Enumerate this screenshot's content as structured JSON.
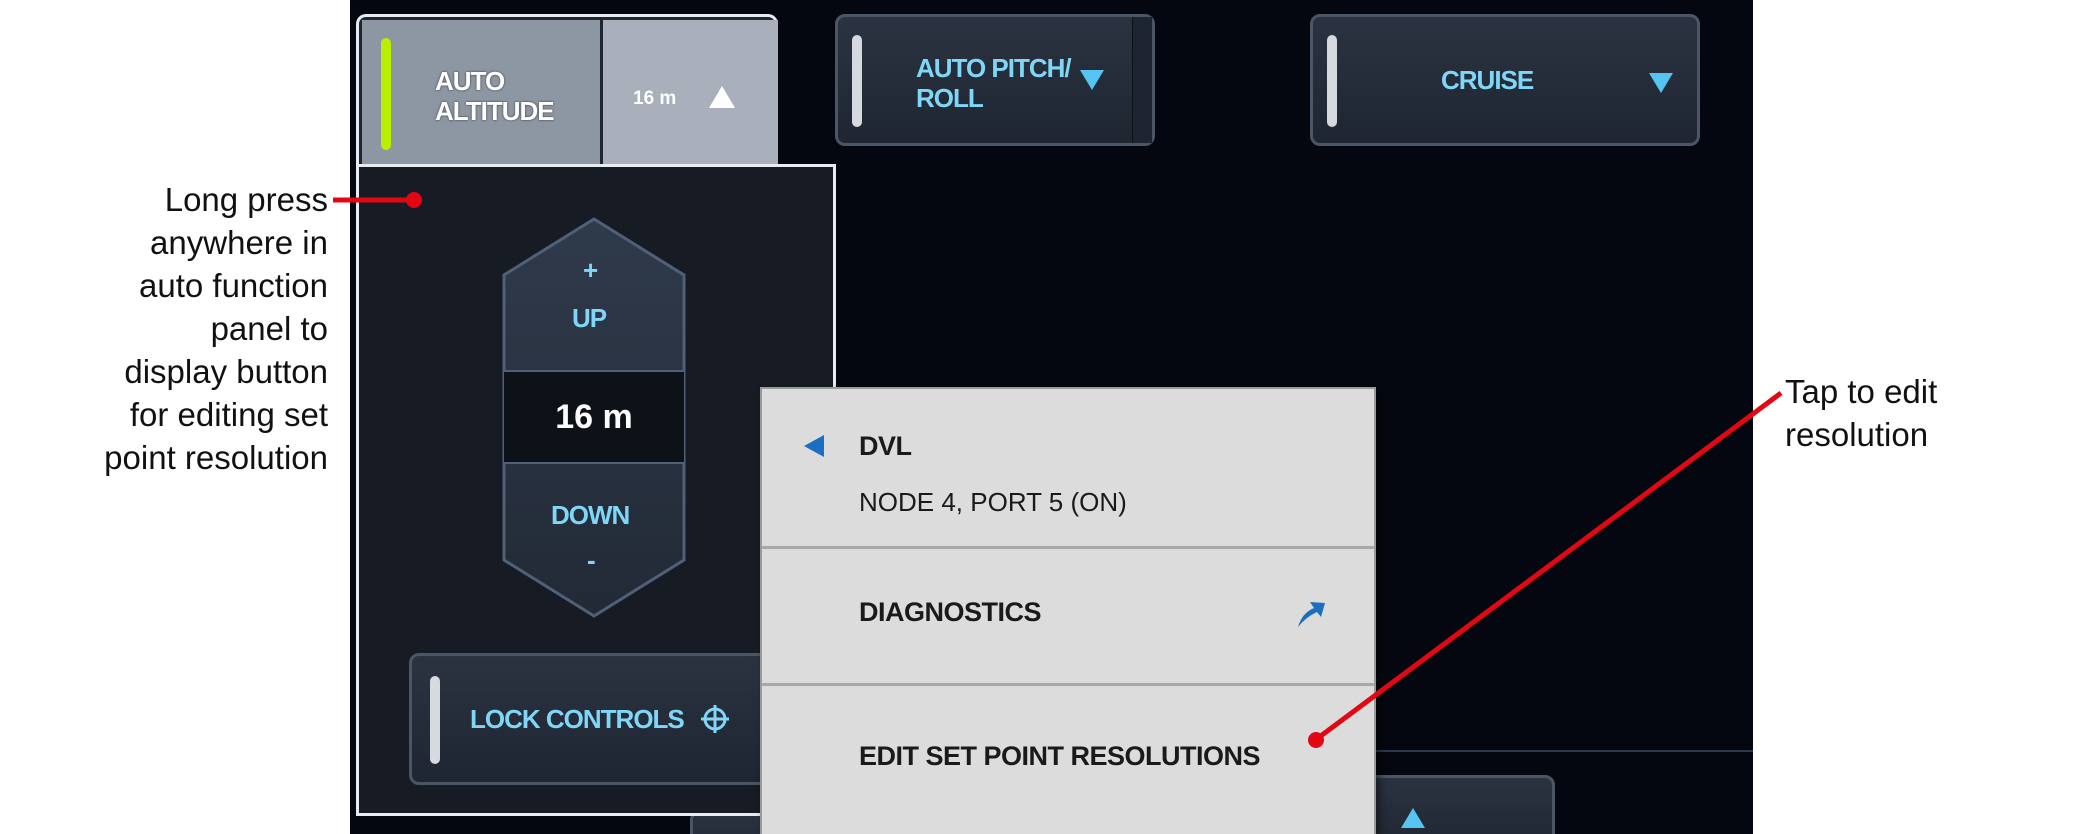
{
  "annotations": {
    "left_note": [
      "Long press",
      "anywhere in",
      "auto function",
      "panel to",
      "display button",
      "for editing set",
      "point resolution"
    ],
    "right_note": [
      "Tap to edit",
      "resolution"
    ],
    "callout_color": "#e30613"
  },
  "top_bar": {
    "auto_altitude": {
      "label_line1": "AUTO",
      "label_line2": "ALTITUDE",
      "value": "16 m",
      "indicator_color": "#b8f000"
    },
    "auto_pitch_roll": {
      "label_line1": "AUTO PITCH/",
      "label_line2": "ROLL"
    },
    "cruise": {
      "label": "CRUISE"
    }
  },
  "altitude_panel": {
    "plus": "+",
    "up": "UP",
    "value": "16 m",
    "down": "DOWN",
    "minus": "-",
    "lock_controls": "LOCK CONTROLS"
  },
  "context_menu": {
    "title": "DVL",
    "subtitle": "NODE 4, PORT 5 (ON)",
    "diagnostics": "DIAGNOSTICS",
    "edit_resolutions": "EDIT SET POINT RESOLUTIONS",
    "accent_color": "#1a6fc2"
  },
  "colors": {
    "screen_bg": "#04070f",
    "label_cyan": "#7fd6f7",
    "arrow_cyan": "#56c4f0"
  }
}
